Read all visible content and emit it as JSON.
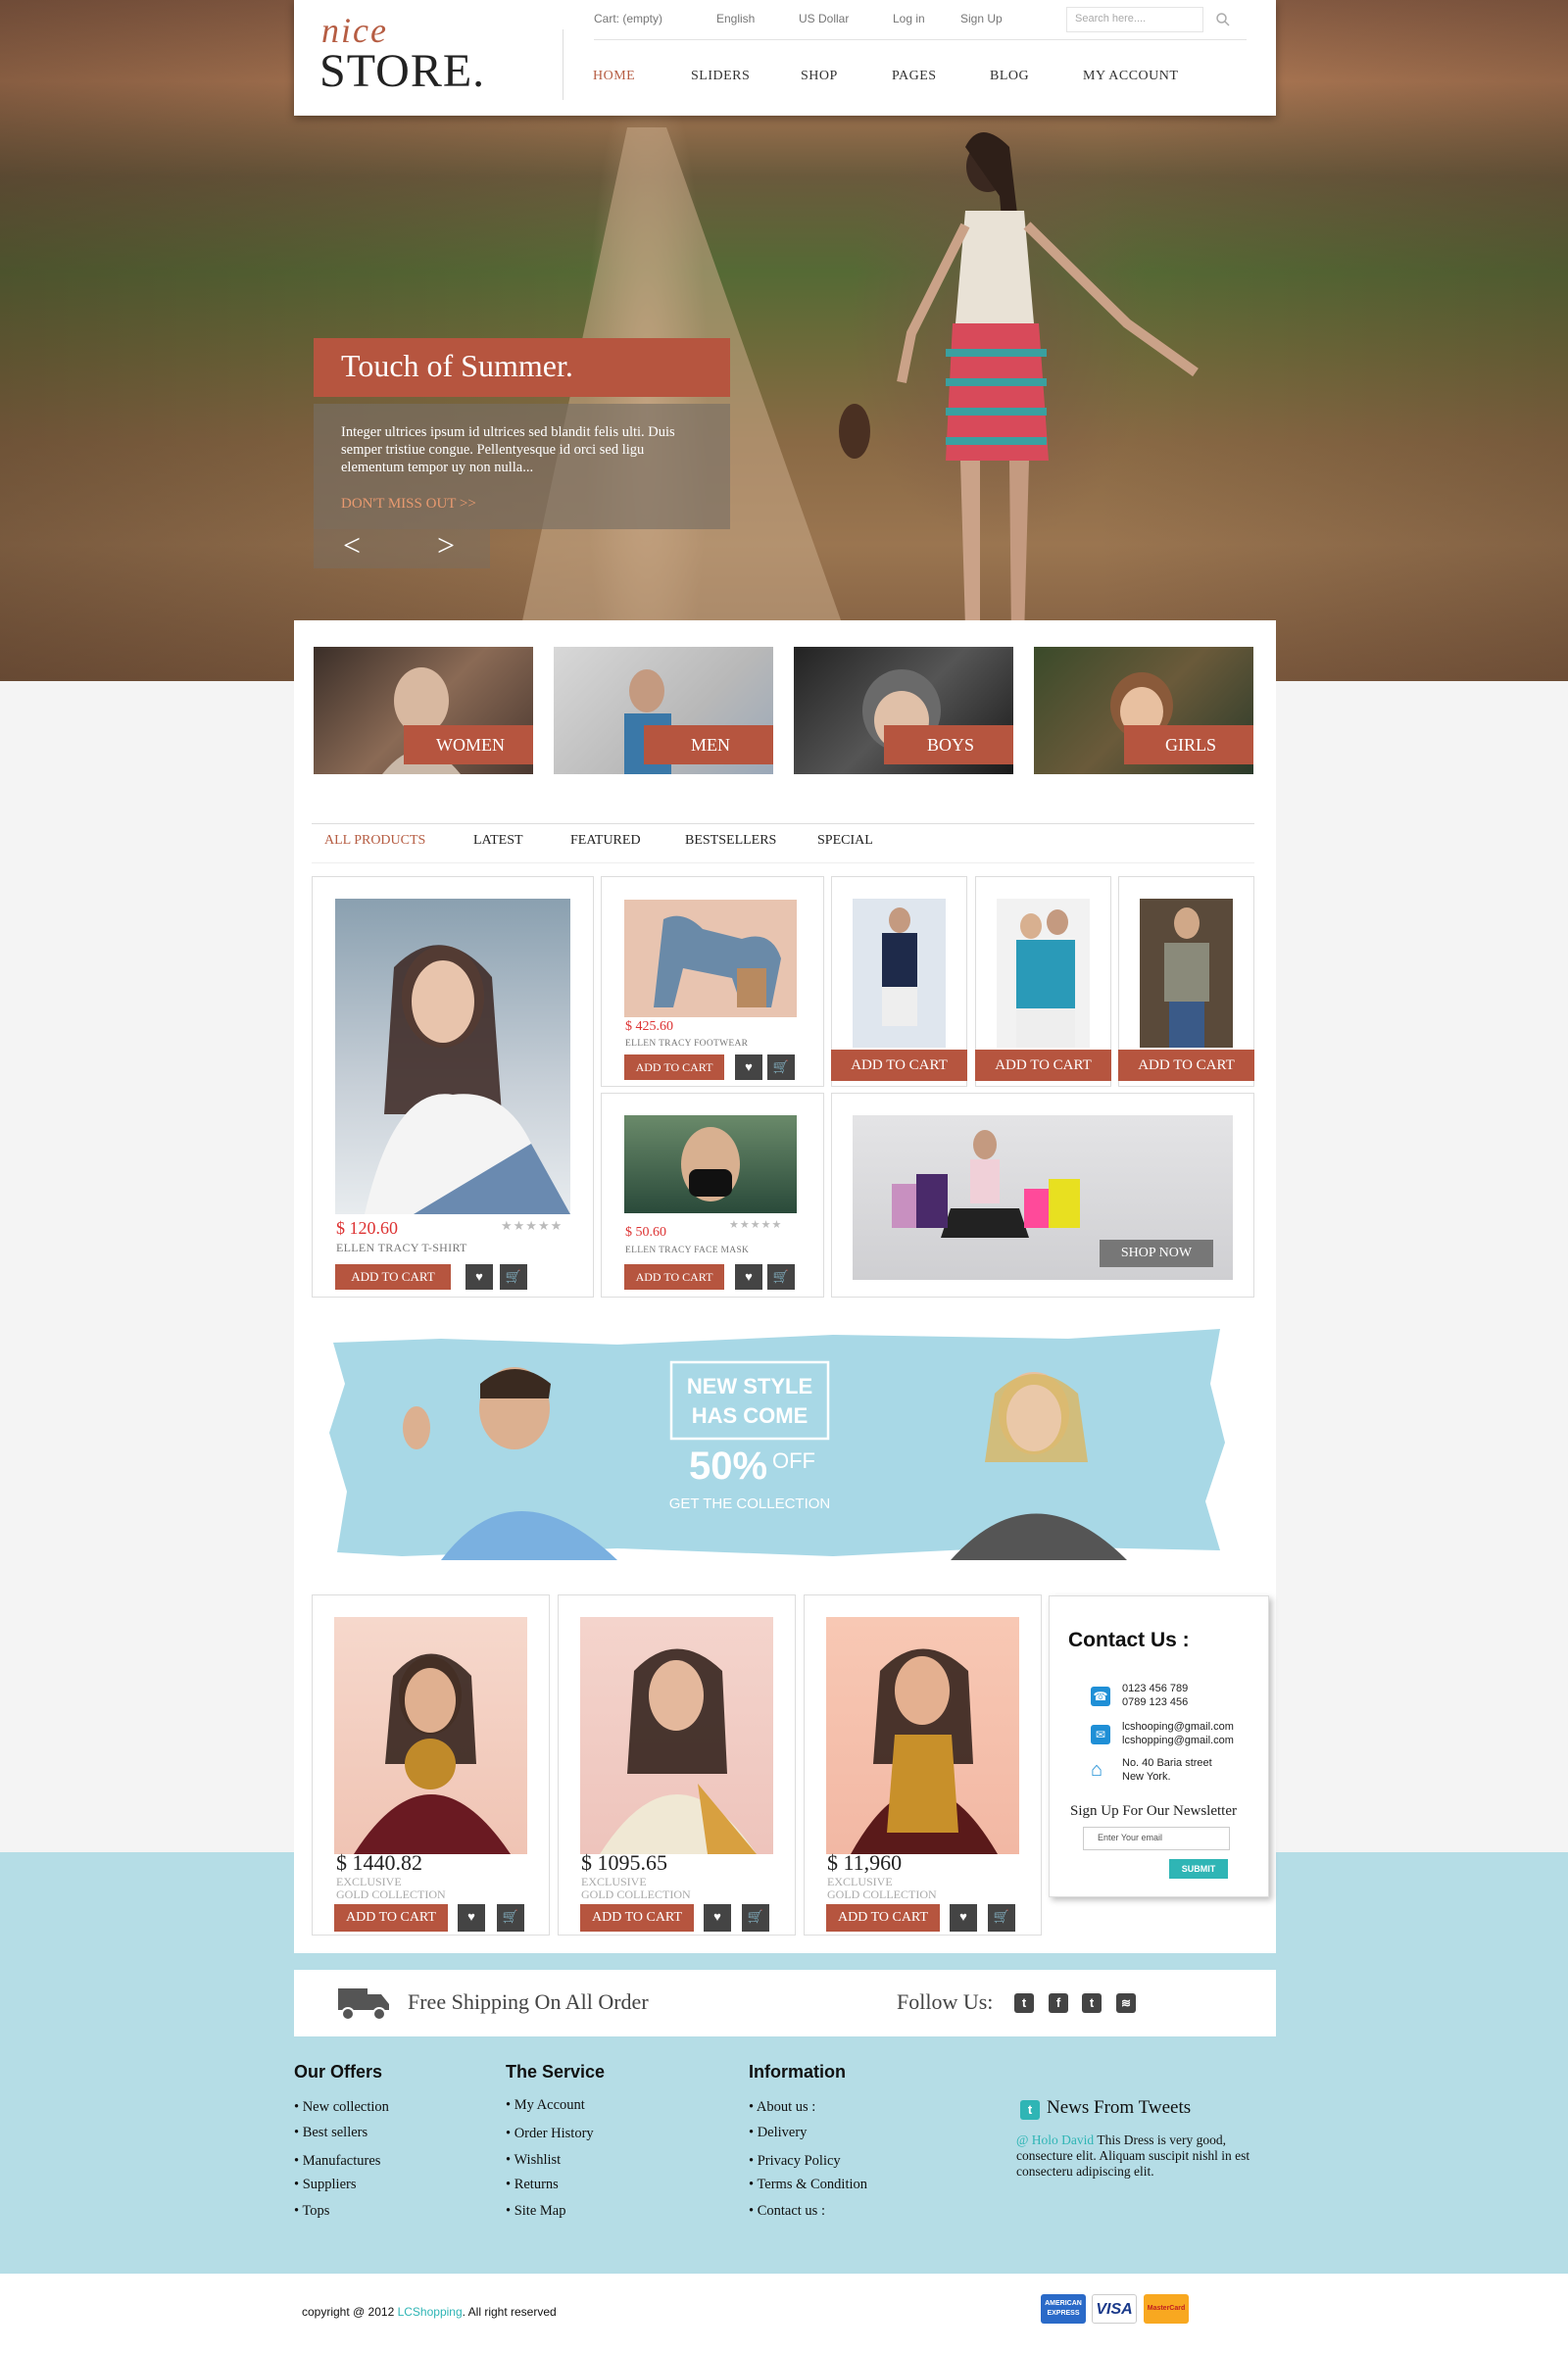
{
  "brand": {
    "nice": "nice",
    "store": "STORE."
  },
  "topbar": {
    "cart": "Cart: (empty)",
    "language": "English",
    "currency": "US Dollar",
    "login": "Log in",
    "signup": "Sign Up",
    "search_placeholder": "Search here...."
  },
  "nav": {
    "items": [
      "HOME",
      "SLIDERS",
      "SHOP",
      "PAGES",
      "BLOG",
      "MY ACCOUNT"
    ],
    "active": "HOME"
  },
  "slider": {
    "title": "Touch of Summer.",
    "body": "Integer ultrices ipsum id ultrices sed blandit felis ulti. Duis semper tristiue congue. Pellentyesque id orci sed ligu elementum tempor uy non nulla...",
    "cta": "DON'T MISS OUT >>",
    "prev": "<",
    "next": ">"
  },
  "categories": [
    "WOMEN",
    "MEN",
    "BOYS",
    "GIRLS"
  ],
  "tabs": {
    "items": [
      "ALL PRODUCTS",
      "LATEST",
      "FEATURED",
      "BESTSELLERS",
      "SPECIAL"
    ],
    "active": "ALL PRODUCTS"
  },
  "products": {
    "featured": {
      "price": "$ 120.60",
      "name": "ELLEN TRACY T-SHIRT",
      "cta": "ADD TO CART",
      "rating": 4
    },
    "footwear": {
      "price": "$ 425.60",
      "name": "ELLEN TRACY FOOTWEAR",
      "cta": "ADD TO CART",
      "rating": 0
    },
    "mask": {
      "price": "$ 50.60",
      "name": "ELLEN TRACY FACE MASK",
      "cta": "ADD TO CART",
      "rating": 4
    },
    "small_cta": "ADD TO CART",
    "shop_now": "SHOP NOW"
  },
  "promo": {
    "line1": "NEW STYLE",
    "line2": "HAS COME",
    "discount": "50%",
    "off": "OFF",
    "tagline": "GET THE COLLECTION"
  },
  "collection": [
    {
      "price": "$ 1440.82",
      "sub1": "EXCLUSIVE",
      "sub2": "GOLD COLLECTION",
      "cta": "ADD TO CART"
    },
    {
      "price": "$ 1095.65",
      "sub1": "EXCLUSIVE",
      "sub2": "GOLD COLLECTION",
      "cta": "ADD TO CART"
    },
    {
      "price": "$ 11,960",
      "sub1": "EXCLUSIVE",
      "sub2": "GOLD COLLECTION",
      "cta": "ADD TO CART"
    }
  ],
  "contact": {
    "title": "Contact Us :",
    "phone1": "0123 456 789",
    "phone2": "0789 123 456",
    "email1": "lcshooping@gmail.com",
    "email2": "lcshopping@gmail.com",
    "addr1": "No. 40 Baria street",
    "addr2": "New York.",
    "newsletter": "Sign Up For Our Newsletter",
    "email_placeholder": "Enter Your email",
    "submit": "SUBMIT"
  },
  "shipping": {
    "text": "Free Shipping On All Order",
    "follow": "Follow Us:"
  },
  "footer": {
    "offers": {
      "title": "Our Offers",
      "items": [
        "New collection",
        "Best sellers",
        "Manufactures",
        "Suppliers",
        "Tops"
      ]
    },
    "service": {
      "title": "The Service",
      "items": [
        "My Account",
        "Order History",
        "Wishlist",
        "Returns",
        "Site Map"
      ]
    },
    "info": {
      "title": "Information",
      "items": [
        "About us :",
        "Delivery",
        "Privacy Policy",
        "Terms & Condition",
        "Contact us :"
      ]
    },
    "tweets": {
      "title": "News From Tweets",
      "handle": "@ Holo David",
      "text": "This Dress is very good, consecture elit. Aliquam suscipit nishl in est consecteru adipiscing elit."
    }
  },
  "copyright": {
    "prefix": "copyright @ 2012 ",
    "brand": "LCShopping",
    "suffix": ". All right reserved"
  },
  "payments": [
    "AMERICAN EXPRESS",
    "VISA",
    "MasterCard"
  ],
  "colors": {
    "accent": "#b6553f",
    "light_blue": "#b5dde6",
    "teal": "#2fb5b5"
  }
}
